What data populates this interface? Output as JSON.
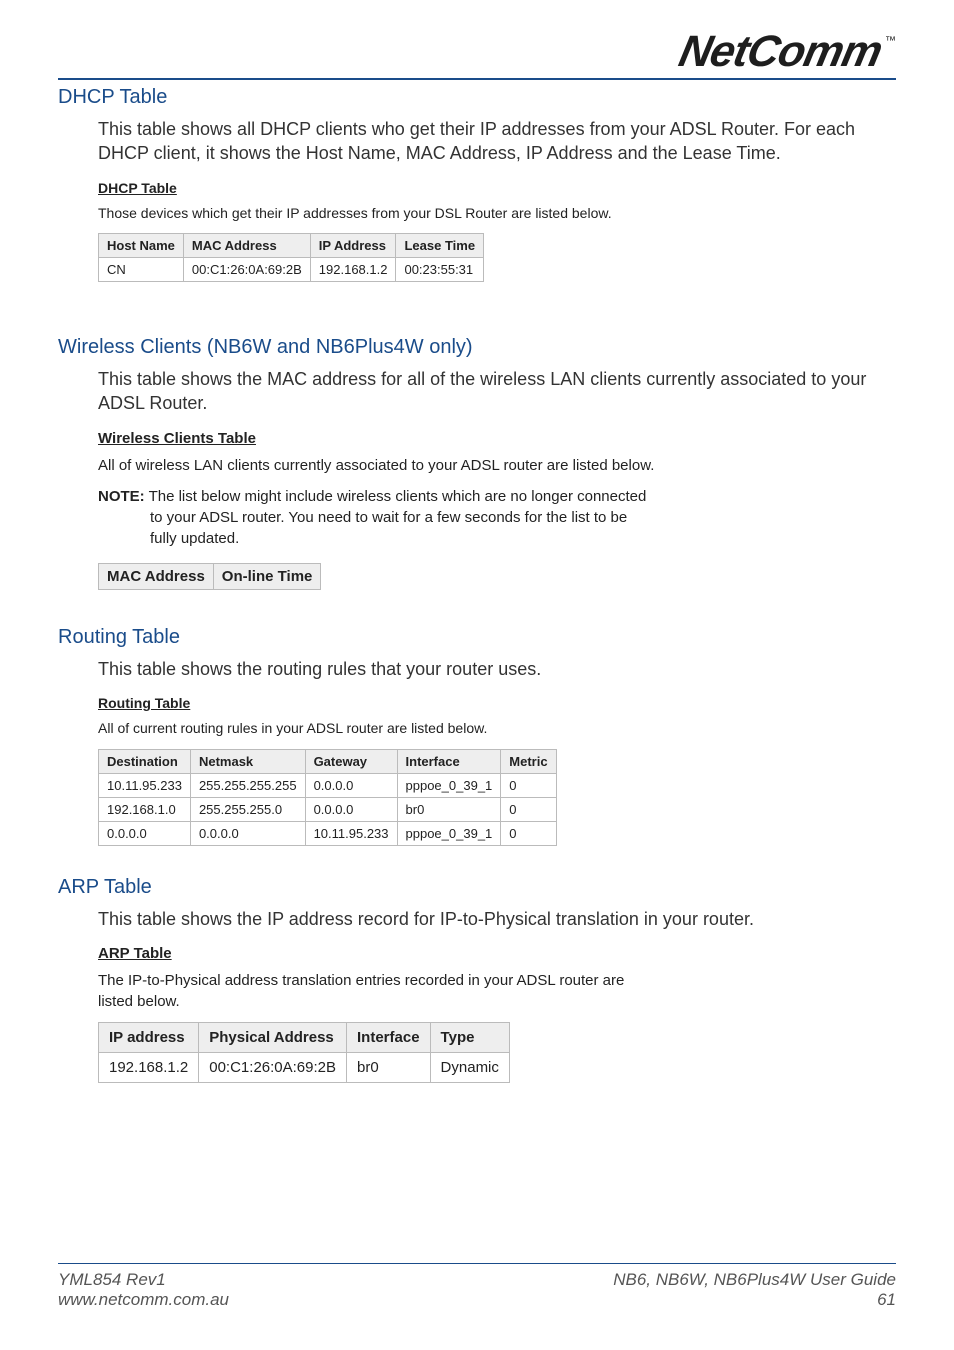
{
  "brand": {
    "name": "NetComm",
    "tm": "™"
  },
  "sections": {
    "dhcp": {
      "heading": "DHCP Table",
      "body_pre": "This table shows all DHCP clients who get their IP addresses from your ADSL Router. For each DHCP client, it shows the ",
      "body_b1": "Host Name",
      "body_sep1": ", ",
      "body_b2": "MAC Address",
      "body_sep2": ", ",
      "body_b3": "IP Address",
      "body_sep3": " and the ",
      "body_b4": "Lease Time",
      "body_post": ".",
      "ss_title": "DHCP Table",
      "ss_desc": "Those devices which get their IP addresses from your DSL Router are listed below.",
      "table": {
        "headers": [
          "Host Name",
          "MAC Address",
          "IP Address",
          "Lease Time"
        ],
        "rows": [
          [
            "CN",
            "00:C1:26:0A:69:2B",
            "192.168.1.2",
            "00:23:55:31"
          ]
        ]
      }
    },
    "wireless": {
      "heading": "Wireless Clients (NB6W and NB6Plus4W only)",
      "body": "This table shows the MAC address for all of the wireless LAN clients currently associated to your ADSL Router.",
      "ss_title": "Wireless Clients Table",
      "ss_desc": "All of wireless LAN clients currently associated to your ADSL router are listed below.",
      "ss_note_label": "NOTE:",
      "ss_note_text": " The list below might include wireless clients which are no longer connected to your ADSL router. You need to wait for a few seconds for the list to be fully updated.",
      "table": {
        "headers": [
          "MAC Address",
          "On-line Time"
        ]
      }
    },
    "routing": {
      "heading": "Routing Table",
      "body": "This table shows the routing rules that your router uses.",
      "ss_title": "Routing Table",
      "ss_desc": "All of current routing rules in your ADSL router are listed below.",
      "table": {
        "headers": [
          "Destination",
          "Netmask",
          "Gateway",
          "Interface",
          "Metric"
        ],
        "rows": [
          [
            "10.11.95.233",
            "255.255.255.255",
            "0.0.0.0",
            "pppoe_0_39_1",
            "0"
          ],
          [
            "192.168.1.0",
            "255.255.255.0",
            "0.0.0.0",
            "br0",
            "0"
          ],
          [
            "0.0.0.0",
            "0.0.0.0",
            "10.11.95.233",
            "pppoe_0_39_1",
            "0"
          ]
        ]
      }
    },
    "arp": {
      "heading": "ARP Table",
      "body": "This table shows the IP address record for IP-to-Physical translation in your router.",
      "ss_title": "ARP Table",
      "ss_desc": "The IP-to-Physical address translation entries recorded in your ADSL router are listed below.",
      "table": {
        "headers": [
          "IP address",
          "Physical Address",
          "Interface",
          "Type"
        ],
        "rows": [
          [
            "192.168.1.2",
            "00:C1:26:0A:69:2B",
            "br0",
            "Dynamic"
          ]
        ]
      }
    }
  },
  "footer": {
    "left1": "YML854 Rev1",
    "left2": "www.netcomm.com.au",
    "right1_models": "NB6, NB6W, NB6Plus4W ",
    "right1_ug": "User Guide",
    "right2": "61"
  }
}
